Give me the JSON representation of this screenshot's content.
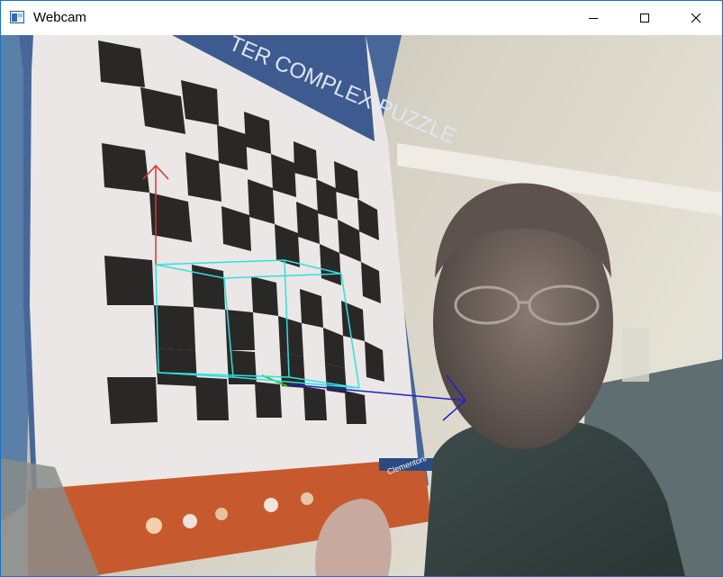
{
  "window": {
    "title": "Webcam",
    "controls": [
      "minimize",
      "maximize",
      "close"
    ]
  },
  "frame": {
    "board_text": "TER COMPLEX PUZZLE",
    "brand_text": "Clementoni",
    "overlay_colors": {
      "axis_z": "#e03030",
      "axis_x": "#2020d0",
      "cube": "#30e0e0"
    }
  }
}
